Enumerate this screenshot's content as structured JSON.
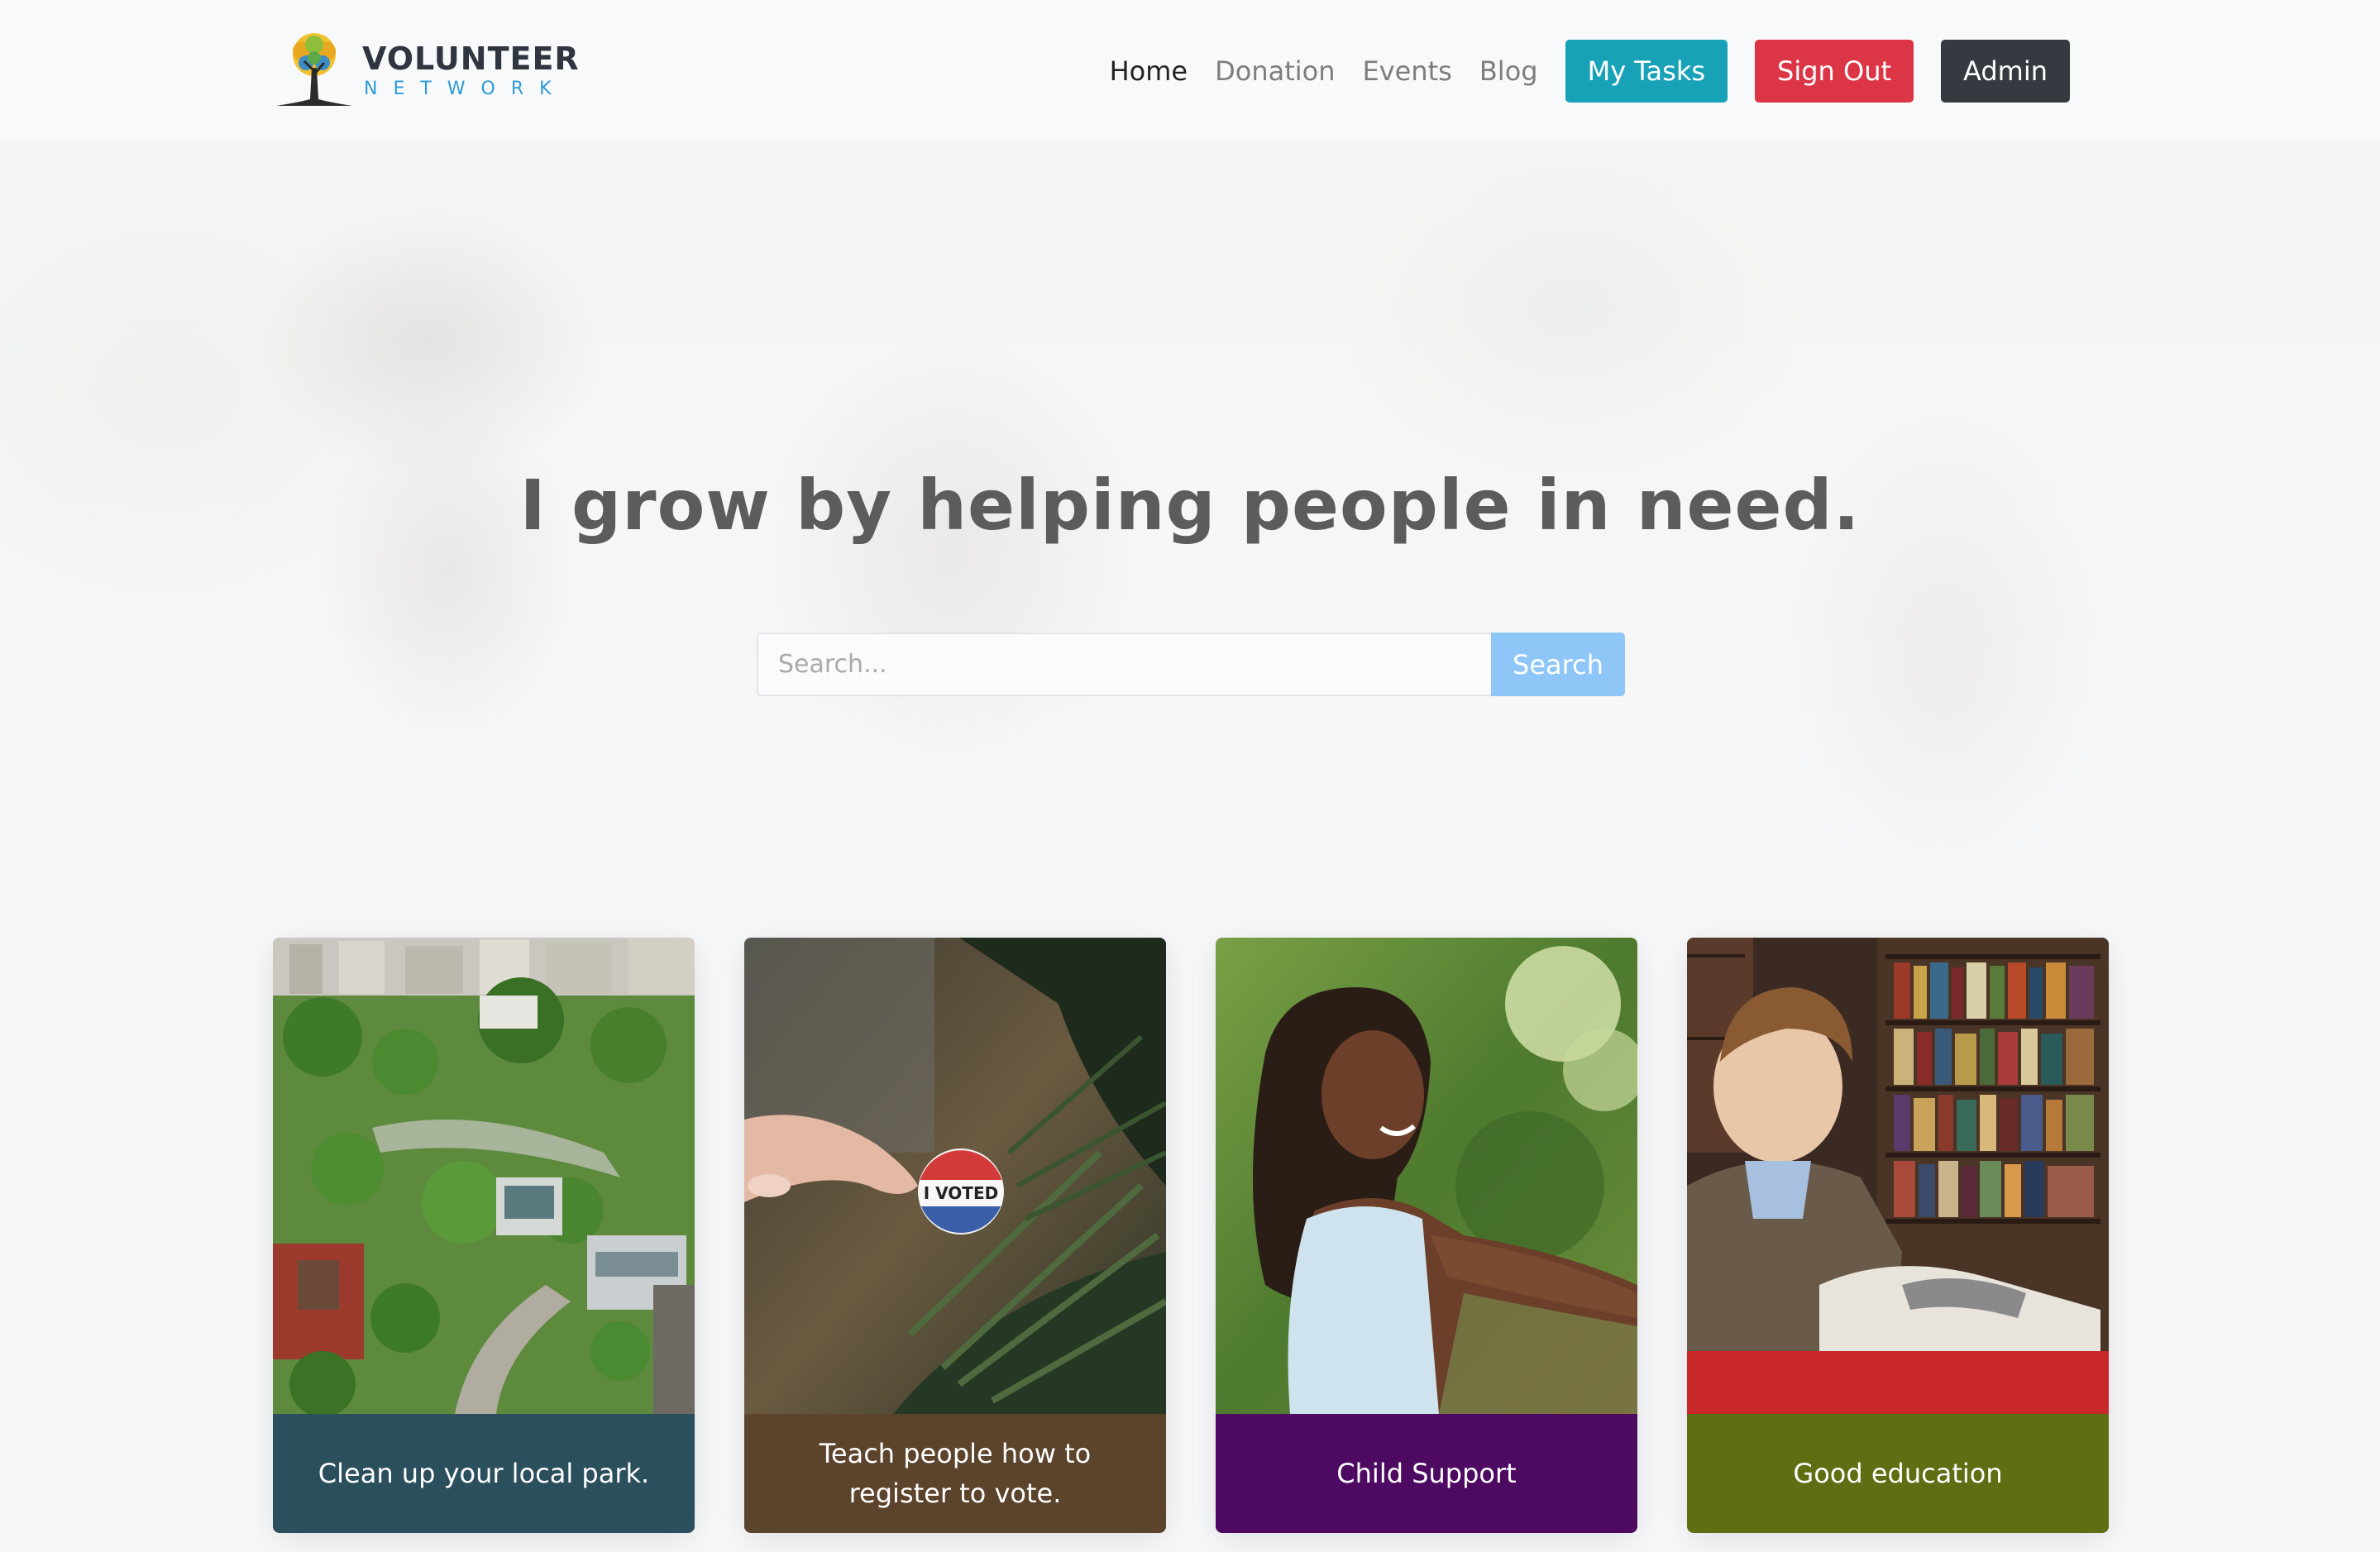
{
  "brand": {
    "name": "VOLUNTEER",
    "subtitle": "NETWORK"
  },
  "nav": {
    "links": [
      "Home",
      "Donation",
      "Events",
      "Blog"
    ],
    "buttons": {
      "tasks": "My Tasks",
      "signout": "Sign Out",
      "admin": "Admin"
    }
  },
  "hero": {
    "title": "I grow by helping people in need.",
    "search": {
      "placeholder": "Search...",
      "button": "Search"
    }
  },
  "cards": [
    {
      "caption": "Clean up your local park.",
      "color": "#2c4f5e",
      "image": "park-image"
    },
    {
      "caption": "Teach people how to register to vote.",
      "color": "#5c432b",
      "image": "voted-sticker-image"
    },
    {
      "caption": "Child Support",
      "color": "#4e0a62",
      "image": "smiling-girl-image"
    },
    {
      "caption": "Good education",
      "color": "#5e6e12",
      "image": "boy-reading-image"
    }
  ],
  "sticker_text": "I VOTED",
  "colors": {
    "tasks": "#17a2b8",
    "signout": "#dc3545",
    "admin": "#343a40",
    "search": "#8ec7f7"
  }
}
